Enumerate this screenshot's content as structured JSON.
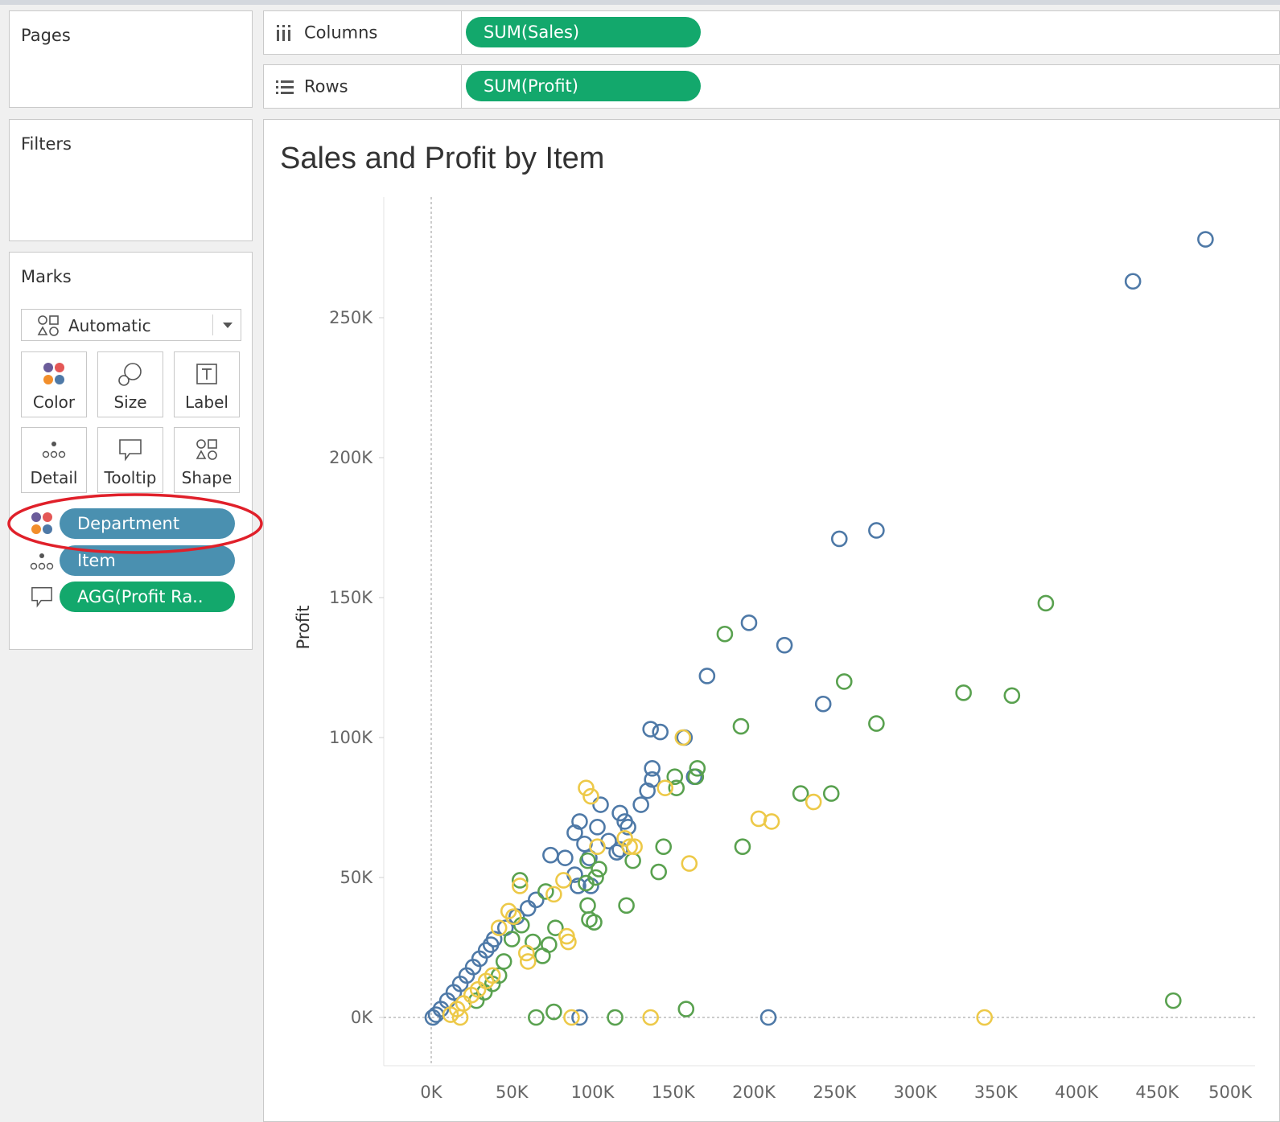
{
  "shelves": {
    "pages_title": "Pages",
    "filters_title": "Filters",
    "marks_title": "Marks",
    "columns": {
      "label": "Columns",
      "pill": "SUM(Sales)"
    },
    "rows": {
      "label": "Rows",
      "pill": "SUM(Profit)"
    }
  },
  "marks": {
    "mark_type": "Automatic",
    "buttons": [
      {
        "label": "Color",
        "icon": "color-icon"
      },
      {
        "label": "Size",
        "icon": "size-icon"
      },
      {
        "label": "Label",
        "icon": "label-icon"
      },
      {
        "label": "Detail",
        "icon": "detail-icon"
      },
      {
        "label": "Tooltip",
        "icon": "tooltip-icon"
      },
      {
        "label": "Shape",
        "icon": "shape-icon"
      }
    ],
    "fields": [
      {
        "label": "Department",
        "encoding": "color",
        "color": "#4a90b0"
      },
      {
        "label": "Item",
        "encoding": "detail",
        "color": "#4a90b0"
      },
      {
        "label": "AGG(Profit Ra..",
        "encoding": "tooltip",
        "color": "#13a86c"
      }
    ],
    "highlight_color": "#e0202a"
  },
  "chart_data": {
    "type": "scatter",
    "title": "Sales and Profit by Item",
    "xlabel": "",
    "ylabel": "Profit",
    "x_ticks": [
      "0K",
      "50K",
      "100K",
      "150K",
      "200K",
      "250K",
      "300K",
      "350K",
      "400K",
      "450K",
      "500K"
    ],
    "y_ticks": [
      "0K",
      "50K",
      "100K",
      "150K",
      "200K",
      "250K"
    ],
    "xlim": [
      0,
      505
    ],
    "ylim": [
      -16,
      282
    ],
    "units": "thousands",
    "series": [
      {
        "color": "#4e79a7",
        "points": [
          [
            480,
            278
          ],
          [
            435,
            263
          ],
          [
            276,
            174
          ],
          [
            253,
            171
          ],
          [
            197,
            141
          ],
          [
            171,
            122
          ],
          [
            219,
            133
          ],
          [
            243,
            112
          ],
          [
            136,
            103
          ],
          [
            142,
            102
          ],
          [
            157,
            100
          ],
          [
            137,
            89
          ],
          [
            137,
            85
          ],
          [
            134,
            81
          ],
          [
            163,
            86
          ],
          [
            130,
            76
          ],
          [
            105,
            76
          ],
          [
            117,
            73
          ],
          [
            120,
            70
          ],
          [
            122,
            68
          ],
          [
            92,
            70
          ],
          [
            89,
            66
          ],
          [
            103,
            68
          ],
          [
            95,
            62
          ],
          [
            110,
            63
          ],
          [
            115,
            59
          ],
          [
            117,
            60
          ],
          [
            74,
            58
          ],
          [
            83,
            57
          ],
          [
            98,
            57
          ],
          [
            89,
            51
          ],
          [
            91,
            47
          ],
          [
            99,
            47
          ],
          [
            65,
            42
          ],
          [
            60,
            39
          ],
          [
            53,
            36
          ],
          [
            46,
            32
          ],
          [
            39,
            28
          ],
          [
            37,
            26
          ],
          [
            34,
            24
          ],
          [
            30,
            21
          ],
          [
            26,
            18
          ],
          [
            22,
            15
          ],
          [
            18,
            12
          ],
          [
            14,
            9
          ],
          [
            10,
            6
          ],
          [
            6,
            3
          ],
          [
            3,
            1
          ],
          [
            1,
            0
          ],
          [
            209,
            0
          ],
          [
            92,
            0
          ]
        ]
      },
      {
        "color": "#59a14f",
        "points": [
          [
            381,
            148
          ],
          [
            182,
            137
          ],
          [
            256,
            120
          ],
          [
            192,
            104
          ],
          [
            276,
            105
          ],
          [
            330,
            116
          ],
          [
            360,
            115
          ],
          [
            165,
            89
          ],
          [
            164,
            86
          ],
          [
            151,
            86
          ],
          [
            152,
            82
          ],
          [
            229,
            80
          ],
          [
            248,
            80
          ],
          [
            193,
            61
          ],
          [
            144,
            61
          ],
          [
            141,
            52
          ],
          [
            125,
            56
          ],
          [
            121,
            40
          ],
          [
            97,
            56
          ],
          [
            104,
            53
          ],
          [
            102,
            50
          ],
          [
            96,
            48
          ],
          [
            55,
            49
          ],
          [
            71,
            45
          ],
          [
            97,
            40
          ],
          [
            98,
            35
          ],
          [
            101,
            34
          ],
          [
            77,
            32
          ],
          [
            63,
            27
          ],
          [
            73,
            26
          ],
          [
            69,
            22
          ],
          [
            45,
            20
          ],
          [
            50,
            28
          ],
          [
            56,
            33
          ],
          [
            42,
            15
          ],
          [
            38,
            12
          ],
          [
            33,
            9
          ],
          [
            28,
            6
          ],
          [
            460,
            6
          ],
          [
            158,
            3
          ],
          [
            76,
            2
          ],
          [
            65,
            0
          ],
          [
            114,
            0
          ]
        ]
      },
      {
        "color": "#edc948",
        "points": [
          [
            156,
            100
          ],
          [
            96,
            82
          ],
          [
            99,
            79
          ],
          [
            145,
            82
          ],
          [
            203,
            71
          ],
          [
            211,
            70
          ],
          [
            237,
            77
          ],
          [
            160,
            55
          ],
          [
            120,
            64
          ],
          [
            123,
            61
          ],
          [
            126,
            61
          ],
          [
            103,
            61
          ],
          [
            82,
            49
          ],
          [
            76,
            44
          ],
          [
            55,
            47
          ],
          [
            48,
            38
          ],
          [
            42,
            32
          ],
          [
            51,
            36
          ],
          [
            84,
            29
          ],
          [
            85,
            27
          ],
          [
            60,
            20
          ],
          [
            59,
            23
          ],
          [
            38,
            15
          ],
          [
            34,
            13
          ],
          [
            29,
            10
          ],
          [
            25,
            8
          ],
          [
            20,
            5
          ],
          [
            16,
            3
          ],
          [
            12,
            1
          ],
          [
            343,
            0
          ],
          [
            136,
            0
          ],
          [
            87,
            0
          ],
          [
            18,
            0
          ]
        ]
      }
    ]
  }
}
